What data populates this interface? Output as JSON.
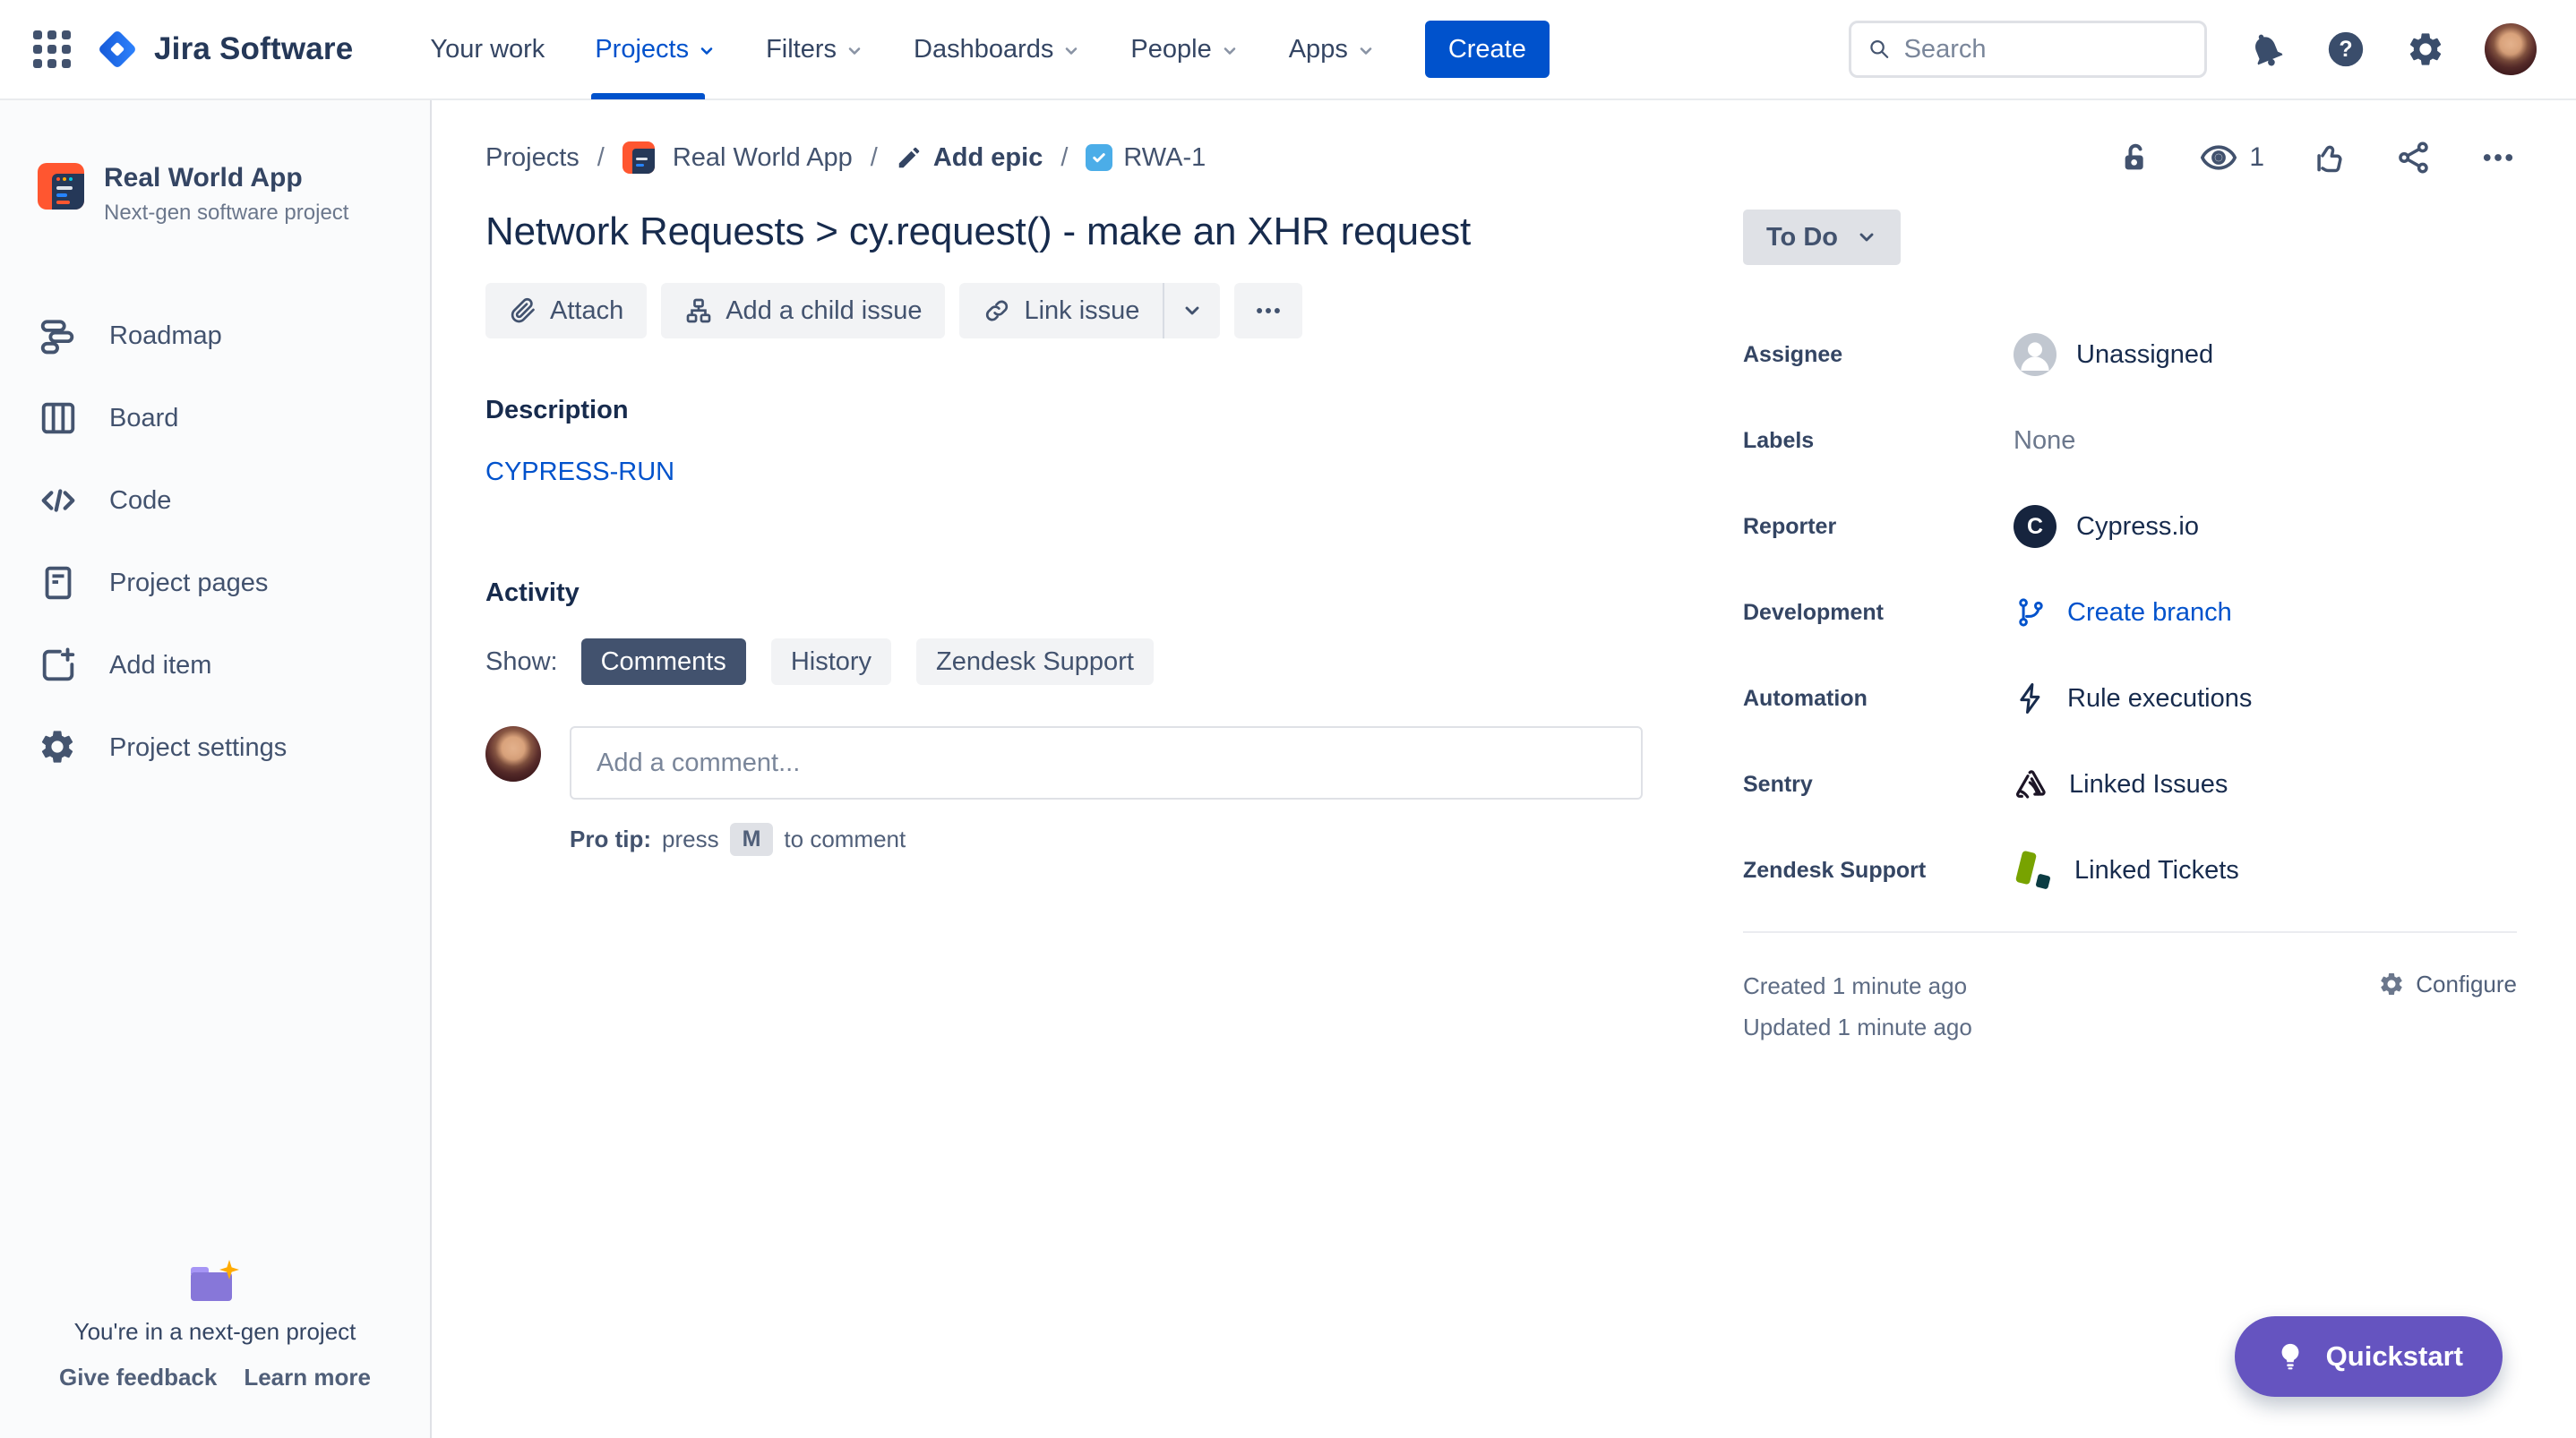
{
  "colors": {
    "accent_blue": "#0052CC",
    "brand_blue": "#2684FF",
    "quickstart_purple": "#6554C0",
    "folder_purple": "#8777D9",
    "sparkle_yellow": "#FFAB00",
    "zendesk_green": "#78A300",
    "zendesk_dark": "#03363D",
    "task_badge_blue": "#4BADE8",
    "project_icon_orange": "#FF5630",
    "status_bg": "#DFE1E6",
    "selected_tab_bg": "#42526E"
  },
  "header": {
    "product_name": "Jira Software",
    "nav": [
      {
        "label": "Your work"
      },
      {
        "label": "Projects"
      },
      {
        "label": "Filters"
      },
      {
        "label": "Dashboards"
      },
      {
        "label": "People"
      },
      {
        "label": "Apps"
      }
    ],
    "create_label": "Create",
    "search_placeholder": "Search"
  },
  "sidebar": {
    "project_name": "Real World App",
    "project_type": "Next-gen software project",
    "items": [
      {
        "label": "Roadmap"
      },
      {
        "label": "Board"
      },
      {
        "label": "Code"
      },
      {
        "label": "Project pages"
      },
      {
        "label": "Add item"
      },
      {
        "label": "Project settings"
      }
    ],
    "footer": {
      "message": "You're in a next-gen project",
      "give_feedback": "Give feedback",
      "learn_more": "Learn more"
    }
  },
  "breadcrumb": {
    "projects": "Projects",
    "project": "Real World App",
    "add_epic": "Add epic",
    "issue_key": "RWA-1",
    "separator": "/"
  },
  "toolbar": {
    "watch_count": "1"
  },
  "issue": {
    "title": "Network Requests > cy.request() - make an XHR request",
    "attach_label": "Attach",
    "add_child_label": "Add a child issue",
    "link_issue_label": "Link issue",
    "description_heading": "Description",
    "description_link": "CYPRESS-RUN",
    "activity_heading": "Activity",
    "show_label": "Show:",
    "tabs": [
      {
        "label": "Comments",
        "selected": true
      },
      {
        "label": "History",
        "selected": false
      },
      {
        "label": "Zendesk Support",
        "selected": false
      }
    ],
    "comment_placeholder": "Add a comment...",
    "pro_tip_bold": "Pro tip:",
    "pro_tip_pre": "press",
    "pro_tip_key": "M",
    "pro_tip_post": "to comment"
  },
  "details": {
    "status": "To Do",
    "fields": [
      {
        "label": "Assignee",
        "value": "Unassigned"
      },
      {
        "label": "Labels",
        "value": "None"
      },
      {
        "label": "Reporter",
        "value": "Cypress.io",
        "avatar_letter": "C"
      },
      {
        "label": "Development",
        "value": "Create branch"
      },
      {
        "label": "Automation",
        "value": "Rule executions"
      },
      {
        "label": "Sentry",
        "value": "Linked Issues"
      },
      {
        "label": "Zendesk Support",
        "value": "Linked Tickets"
      }
    ],
    "created": "Created 1 minute ago",
    "updated": "Updated 1 minute ago",
    "configure_label": "Configure"
  },
  "quickstart": {
    "label": "Quickstart"
  }
}
